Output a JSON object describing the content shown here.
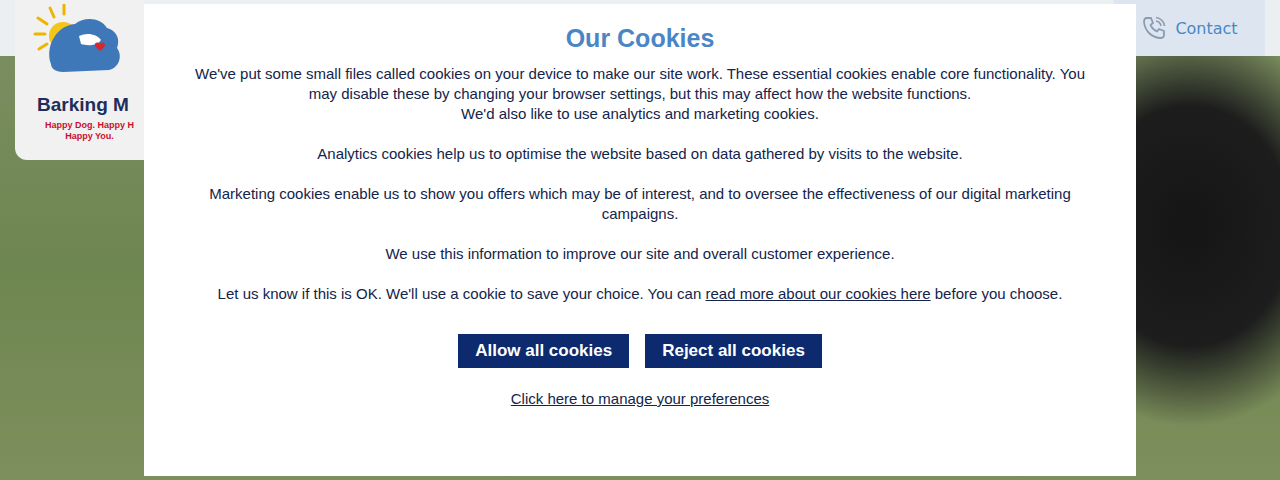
{
  "header": {
    "logo": {
      "name": "Barking M",
      "tagline": [
        "Happy Dog. Happy H",
        "Happy You."
      ]
    },
    "contact": {
      "label": "Contact"
    }
  },
  "cookie_dialog": {
    "title": "Our Cookies",
    "paragraphs": [
      {
        "lines": [
          "We've put some small files called cookies on your device to make our site work. These essential cookies enable core functionality. You may disable these by changing your browser settings, but this may affect how the website functions.",
          "We'd also like to use analytics and marketing cookies."
        ]
      },
      {
        "lines": [
          "Analytics cookies help us to optimise the website based on data gathered by visits to the website."
        ]
      },
      {
        "lines": [
          "Marketing cookies enable us to show you offers which may be of interest, and to oversee the effectiveness of our digital marketing campaigns."
        ]
      },
      {
        "lines": [
          "We use this information to improve our site and overall customer experience."
        ]
      }
    ],
    "consent": {
      "before": "Let us know if this is OK. We'll use a cookie to save your choice. You can ",
      "link": "read more about our cookies here",
      "after": " before you choose."
    },
    "buttons": [
      "Allow all cookies",
      "Reject all cookies"
    ],
    "manage_link": "Click here to manage your preferences"
  }
}
